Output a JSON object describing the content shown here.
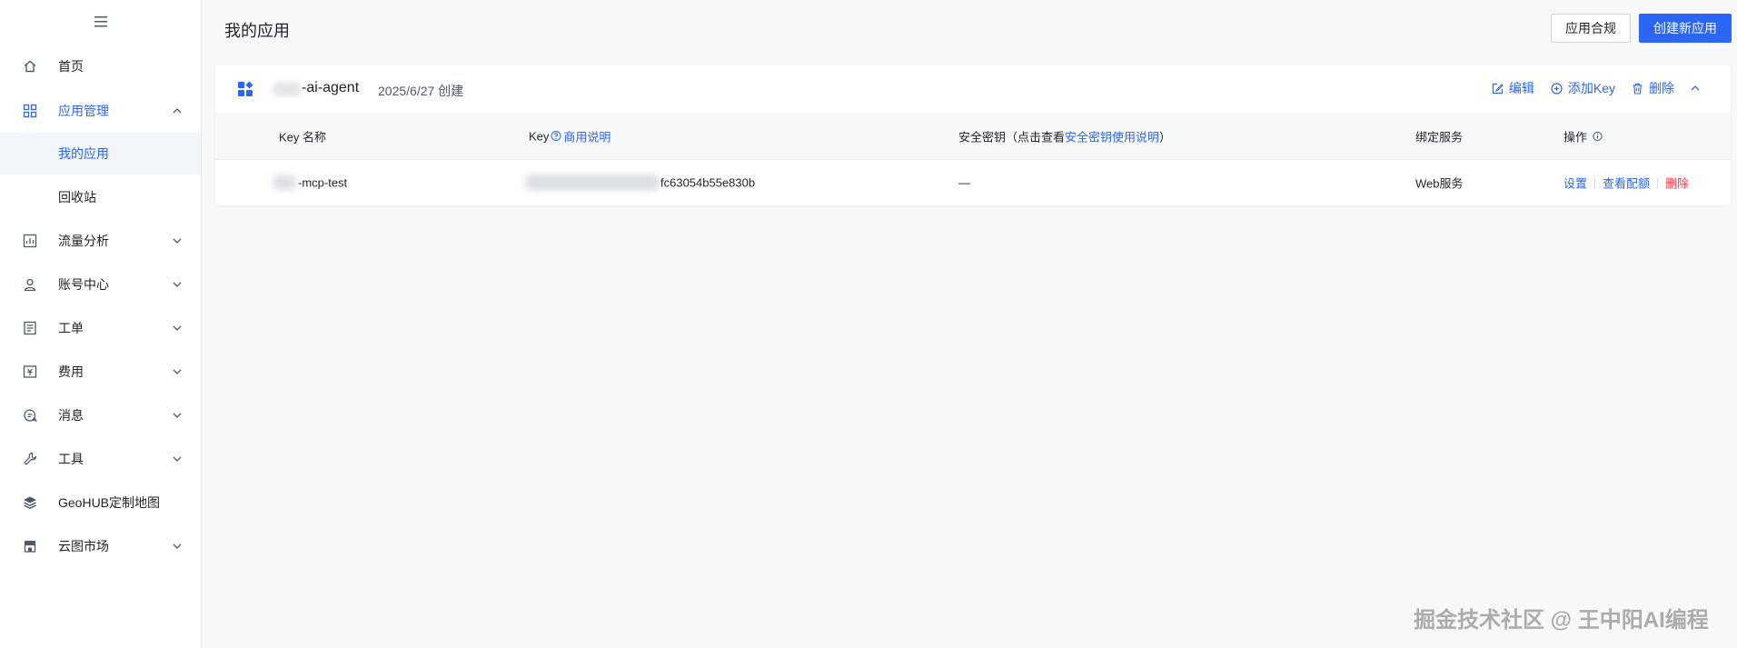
{
  "sidebar": {
    "items": [
      {
        "label": "首页"
      },
      {
        "label": "应用管理"
      },
      {
        "label": "我的应用"
      },
      {
        "label": "回收站"
      },
      {
        "label": "流量分析"
      },
      {
        "label": "账号中心"
      },
      {
        "label": "工单"
      },
      {
        "label": "费用"
      },
      {
        "label": "消息"
      },
      {
        "label": "工具"
      },
      {
        "label": "GeoHUB定制地图"
      },
      {
        "label": "云图市场"
      }
    ]
  },
  "header": {
    "title": "我的应用",
    "compliance_button": "应用合规",
    "create_button": "创建新应用"
  },
  "app": {
    "name": "-ai-agent",
    "created": "2025/6/27 创建",
    "actions": {
      "edit": "编辑",
      "add_key": "添加Key",
      "delete": "删除"
    }
  },
  "table": {
    "headers": {
      "key_name": "Key 名称",
      "key": "Key",
      "key_link": "商用说明",
      "secret_prefix": "安全密钥（点击查看",
      "secret_link": "安全密钥使用说明",
      "secret_suffix": "）",
      "service": "绑定服务",
      "ops": "操作"
    },
    "rows": [
      {
        "key_name": "-mcp-test",
        "key": "fc63054b55e830b",
        "secret": "—",
        "service": "Web服务",
        "ops": {
          "settings": "设置",
          "quota": "查看配额",
          "delete": "删除"
        }
      }
    ]
  },
  "watermark": "掘金技术社区 @ 王中阳AI编程",
  "colors": {
    "accent": "#2b66f6",
    "danger": "#f0424b"
  }
}
